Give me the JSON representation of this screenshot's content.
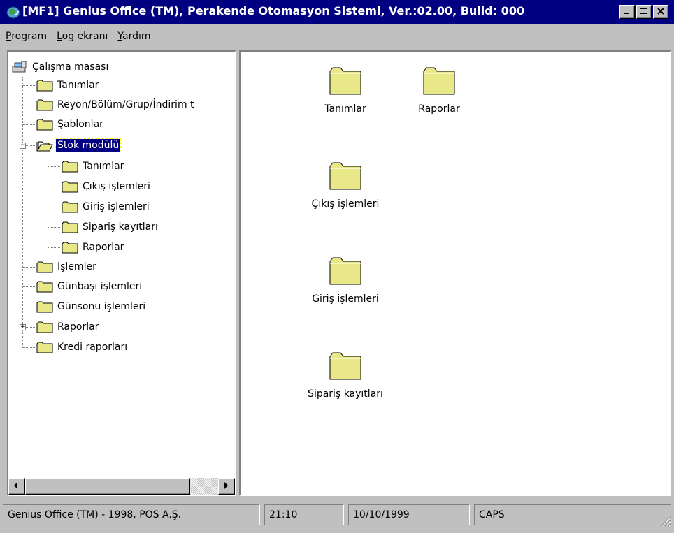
{
  "window": {
    "title": "[MF1] Genius Office (TM), Perakende Otomasyon Sistemi, Ver.:02.00, Build: 000",
    "app_icon": "globe-app-icon",
    "buttons": [
      "minimize",
      "maximize",
      "close"
    ]
  },
  "menu": {
    "items": [
      {
        "label": "Program",
        "mnemonic": "P"
      },
      {
        "label": "Log ekranı",
        "mnemonic": "L"
      },
      {
        "label": "Yardım",
        "mnemonic": "Y"
      }
    ]
  },
  "tree": {
    "root": "Çalışma masası",
    "items": [
      "Tanımlar",
      "Reyon/Bölüm/Grup/İndirim t",
      "Şablonlar",
      "Stok modülü",
      "Tanımlar",
      "Çıkış işlemleri",
      "Giriş işlemleri",
      "Sipariş kayıtları",
      "Raporlar",
      "İşlemler",
      "Günbaşı işlemleri",
      "Günsonu işlemleri",
      "Raporlar",
      "Kredi raporları"
    ],
    "selected": "Stok modülü"
  },
  "icons": {
    "items": [
      "Tanımlar",
      "Raporlar",
      "Çıkış işlemleri",
      "Giriş işlemleri",
      "Sipariş kayıtları"
    ]
  },
  "status": {
    "app": "Genius Office (TM) - 1998, POS A.Ş.",
    "time": "21:10",
    "date": "10/10/1999",
    "caps": "CAPS"
  },
  "colors": {
    "titlebar": "#000080",
    "folder": "#e8e888",
    "selection": "#000080",
    "face": "#c0c0c0"
  }
}
